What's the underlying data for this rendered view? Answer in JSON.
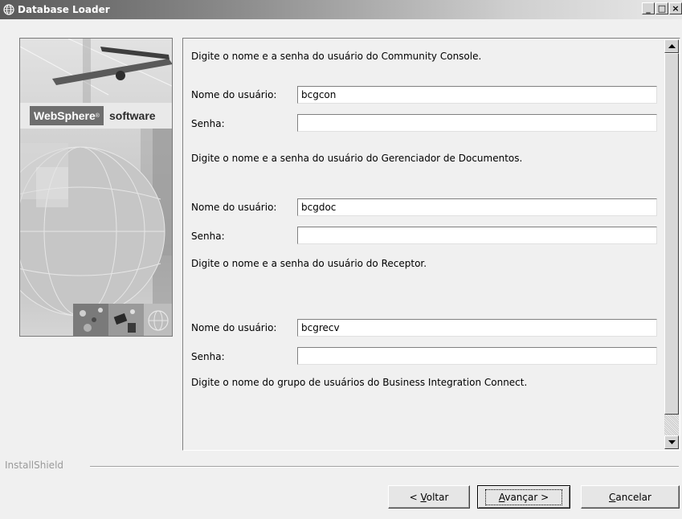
{
  "window": {
    "title": "Database Loader",
    "controls": [
      "_",
      "□",
      "×"
    ]
  },
  "banner": {
    "brand": "WebSphere",
    "brand_mark": "®",
    "product": "software"
  },
  "form": {
    "sections": [
      {
        "prompt": "Digite o nome e a senha do usuário do Community Console.",
        "username_label": "Nome do usuário:",
        "username_value": "bcgcon",
        "password_label": "Senha:",
        "password_value": ""
      },
      {
        "prompt": "Digite o nome e a senha do usuário do Gerenciador de Documentos.",
        "username_label": "Nome do usuário:",
        "username_value": "bcgdoc",
        "password_label": "Senha:",
        "password_value": ""
      },
      {
        "prompt": "Digite o nome e a senha do usuário do Receptor.",
        "username_label": "Nome do usuário:",
        "username_value": "bcgrecv",
        "password_label": "Senha:",
        "password_value": ""
      }
    ],
    "group_prompt": "Digite o nome do grupo de usuários do Business Integration Connect."
  },
  "footer": {
    "installshield": "InstallShield",
    "back_pre": "< ",
    "back_key": "V",
    "back_rest": "oltar",
    "next_key": "A",
    "next_rest": "vançar >",
    "cancel_key": "C",
    "cancel_rest": "ancelar"
  }
}
